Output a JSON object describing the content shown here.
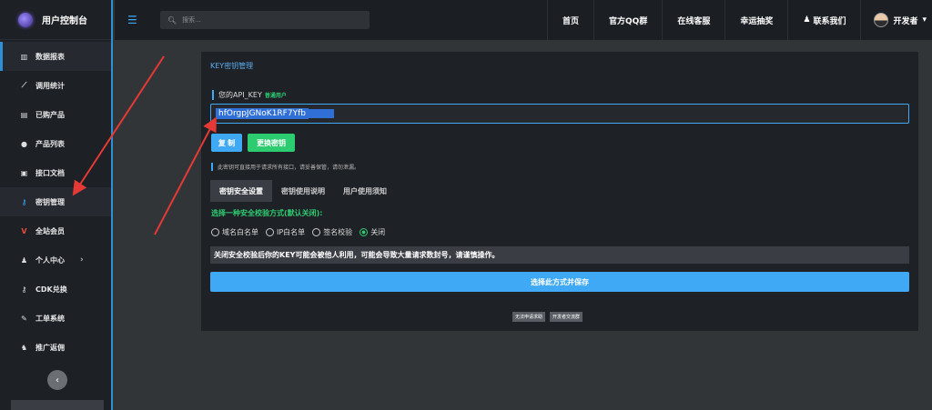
{
  "brand": {
    "title": "用户控制台"
  },
  "sidebar": {
    "items": [
      {
        "label": "数据报表",
        "icon": "bar-chart-icon"
      },
      {
        "label": "调用统计",
        "icon": "line-chart-icon"
      },
      {
        "label": "已购产品",
        "icon": "cart-icon"
      },
      {
        "label": "产品列表",
        "icon": "gear-icon"
      },
      {
        "label": "接口文档",
        "icon": "document-icon"
      },
      {
        "label": "密钥管理",
        "icon": "key-icon"
      },
      {
        "label": "全站会员",
        "icon": "vip-icon"
      },
      {
        "label": "个人中心",
        "icon": "user-icon"
      },
      {
        "label": "CDK兑换",
        "icon": "key-icon"
      },
      {
        "label": "工单系统",
        "icon": "pen-icon"
      },
      {
        "label": "推广返佣",
        "icon": "users-icon"
      }
    ],
    "collapse_icon": "chevron-left-icon"
  },
  "topbar": {
    "search_placeholder": "搜索...",
    "links": [
      "首页",
      "官方QQ群",
      "在线客服",
      "幸运抽奖",
      "联系我们"
    ],
    "user_name": "开发者"
  },
  "panel": {
    "title": "KEY密钥管理",
    "api_key_label": "您的API_KEY",
    "user_badge": "普通用户",
    "api_key_value": "hfOrgpJGNoK1RF7Yfb",
    "copy_label": "复 制",
    "change_label": "更换密钥",
    "note": "此密钥可直接用于请求所有接口，请妥善保管，请勿泄漏。",
    "tabs": [
      "密钥安全设置",
      "密钥使用说明",
      "用户使用须知"
    ],
    "option_heading": "选择一种安全校验方式(默认关闭):",
    "radios": [
      {
        "label": "域名白名单",
        "checked": false
      },
      {
        "label": "IP白名单",
        "checked": false
      },
      {
        "label": "签名校验",
        "checked": false
      },
      {
        "label": "关闭",
        "checked": true
      }
    ],
    "warning": "关闭安全校验后你的KEY可能会被他人利用，可能会导致大量请求数封号，请谨慎操作。",
    "save_label": "选择此方式并保存",
    "small_buttons": [
      "无法申请求助",
      "开发者交流群"
    ]
  },
  "colors": {
    "accent": "#3fa9f5",
    "success": "#2ecc71",
    "annotation": "#e53935"
  }
}
